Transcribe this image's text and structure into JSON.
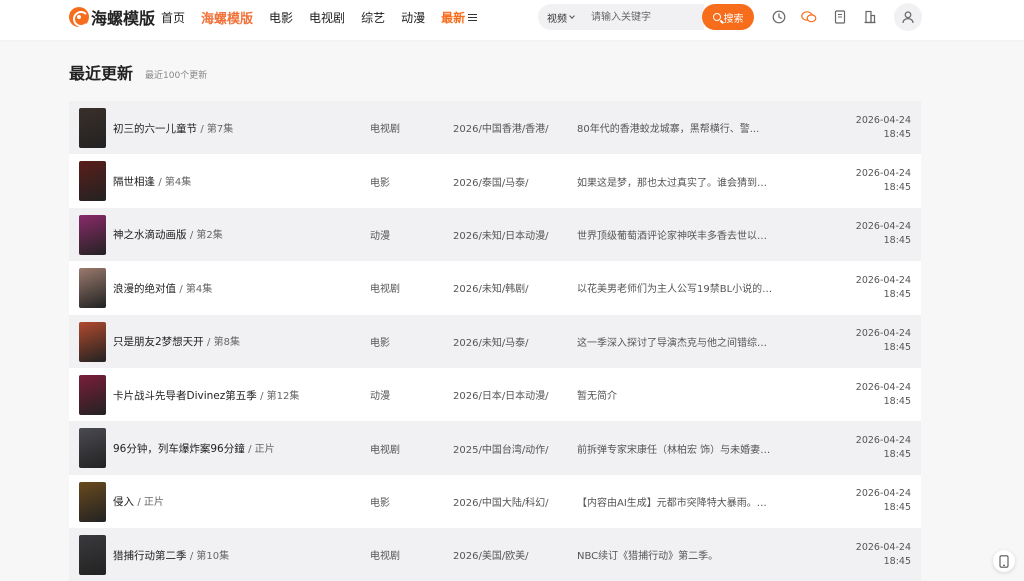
{
  "header": {
    "logo_text": "海螺模版",
    "nav": [
      {
        "label": "首页",
        "style": "normal"
      },
      {
        "label": "海螺模版",
        "style": "brand"
      },
      {
        "label": "电影",
        "style": "normal"
      },
      {
        "label": "电视剧",
        "style": "normal"
      },
      {
        "label": "综艺",
        "style": "normal"
      },
      {
        "label": "动漫",
        "style": "normal"
      },
      {
        "label": "最新",
        "style": "latest"
      }
    ],
    "search": {
      "type_label": "视频",
      "placeholder": "请输入关键字",
      "button_label": "搜索"
    },
    "icons": [
      "history-icon",
      "chat-icon",
      "bookmark-icon",
      "building-icon",
      "user-icon"
    ]
  },
  "page": {
    "title": "最近更新",
    "subtitle": "最近100个更新"
  },
  "colors": {
    "accent": "#f86d1b",
    "brand_text": "#f2733a",
    "row_odd": "#f1f1f3",
    "row_even": "#ffffff"
  },
  "rows": [
    {
      "title": "初三的六一儿童节",
      "episode": "/ 第7集",
      "type": "电视剧",
      "region": "2026/中国香港/香港/",
      "desc": "80年代的香港蛟龙城寨，黑帮横行、警...",
      "date": "2026-04-24",
      "time": "18:45",
      "thumb": "#3a2f2a"
    },
    {
      "title": "隔世相逢",
      "episode": "/ 第4集",
      "type": "电影",
      "region": "2026/泰国/马泰/",
      "desc": "如果这是梦，那也太过真实了。谁会猜到仅...",
      "date": "2026-04-24",
      "time": "18:45",
      "thumb": "#5a1e1a"
    },
    {
      "title": "神之水滴动画版",
      "episode": "/ 第2集",
      "type": "动漫",
      "region": "2026/未知/日本动漫/",
      "desc": "世界顶级葡萄酒评论家神咲丰多香去世以后...",
      "date": "2026-04-24",
      "time": "18:45",
      "thumb": "#8a2a6a"
    },
    {
      "title": "浪漫的绝对值",
      "episode": "/ 第4集",
      "type": "电视剧",
      "region": "2026/未知/韩剧/",
      "desc": "以花美男老师们为主人公写19禁BL小说的女...",
      "date": "2026-04-24",
      "time": "18:45",
      "thumb": "#9a7a6e"
    },
    {
      "title": "只是朋友2梦想天开",
      "episode": "/ 第8集",
      "type": "电影",
      "region": "2026/未知/马泰/",
      "desc": "这一季深入探讨了导演杰克与他之间错综复...",
      "date": "2026-04-24",
      "time": "18:45",
      "thumb": "#b04a2e"
    },
    {
      "title": "卡片战斗先导者Divinez第五季",
      "episode": "/ 第12集",
      "type": "动漫",
      "region": "2026/日本/日本动漫/",
      "desc": "暂无简介",
      "date": "2026-04-24",
      "time": "18:45",
      "thumb": "#7a1e3a"
    },
    {
      "title": "96分钟，列车爆炸案96分鐘",
      "episode": "/ 正片",
      "type": "电视剧",
      "region": "2025/中国台湾/动作/",
      "desc": "前拆弹专家宋康任（林柏宏 饰）与未婚妻黄...",
      "date": "2026-04-24",
      "time": "18:45",
      "thumb": "#4a4a52"
    },
    {
      "title": "侵入",
      "episode": "/ 正片",
      "type": "电影",
      "region": "2026/中国大陆/科幻/",
      "desc": "【内容由AI生成】元都市突降特大暴雨。风...",
      "date": "2026-04-24",
      "time": "18:45",
      "thumb": "#6a4a1e"
    },
    {
      "title": "猎捕行动第二季",
      "episode": "/ 第10集",
      "type": "电视剧",
      "region": "2026/美国/欧美/",
      "desc": "NBC续订《猎捕行动》第二季。",
      "date": "2026-04-24",
      "time": "18:45",
      "thumb": "#3a3a3e"
    }
  ]
}
